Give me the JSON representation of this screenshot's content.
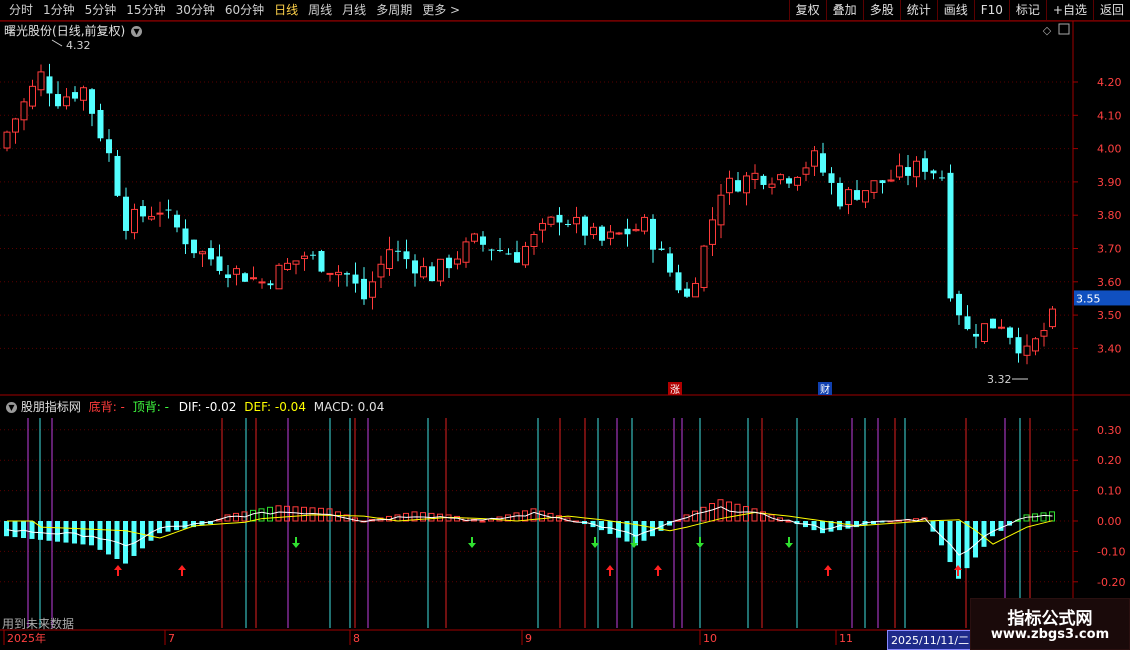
{
  "toolbar": {
    "periods": [
      "分时",
      "1分钟",
      "5分钟",
      "15分钟",
      "30分钟",
      "60分钟",
      "日线",
      "周线",
      "月线",
      "多周期",
      "更多 >"
    ],
    "active_period": "日线",
    "right_buttons": [
      "复权",
      "叠加",
      "多股",
      "统计",
      "画线",
      "F10",
      "标记",
      "+自选",
      "返回"
    ]
  },
  "stock": {
    "name": "曙光股份",
    "mode": "(日线,前复权)",
    "high_label": "4.32",
    "low_label": "3.32",
    "last_price": "3.55",
    "price_axis": [
      "4.20",
      "4.10",
      "4.00",
      "3.90",
      "3.80",
      "3.70",
      "3.60",
      "3.50",
      "3.40"
    ],
    "event_markers": [
      "涨",
      "财"
    ]
  },
  "indicator": {
    "name": "股朋指标网",
    "bottom_div_label": "底背",
    "bottom_div_value": "-",
    "top_div_label": "顶背",
    "top_div_value": "-",
    "dif_label": "DIF: -0.02",
    "def_label": "DEF: -0.04",
    "macd_label": "MACD: 0.04",
    "axis": [
      "0.30",
      "0.20",
      "0.10",
      "0.00",
      "-0.10",
      "-0.20"
    ],
    "future_note": "用到未来数据"
  },
  "time_axis": {
    "labels": [
      "2025年",
      "7",
      "8",
      "9",
      "10",
      "11"
    ],
    "cursor_date": "2025/11/11/二"
  },
  "watermark": {
    "title": "指标公式网",
    "url": "www.zbgs3.com"
  },
  "colors": {
    "up": "#ff3b3b",
    "down": "#54ffff",
    "dif": "#ffffff",
    "dea": "#ffff00",
    "purple_line": "#c040e0",
    "grid": "#8b0000"
  }
}
